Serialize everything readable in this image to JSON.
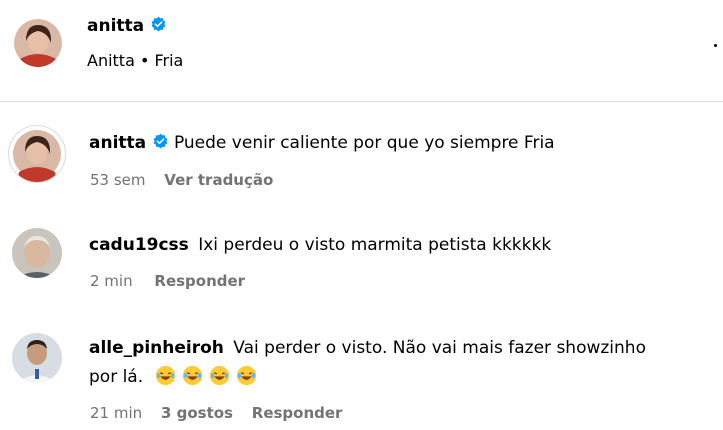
{
  "post_header": {
    "username": "anitta",
    "subtitle": "Anitta • Fria",
    "verified_icon": "verified-badge-icon",
    "menu_icon": "more-options-icon"
  },
  "comments": [
    {
      "username": "anitta",
      "verified": true,
      "text": "Puede venir caliente por que yo siempre Fria",
      "time": "53 sem",
      "action": "Ver tradução"
    },
    {
      "username": "cadu19css",
      "text": "Ixi perdeu o visto marmita petista kkkkkk",
      "time": "2 min",
      "action": "Responder"
    },
    {
      "username": "alle_pinheiroh",
      "text_line1": "Vai perder o visto. Não vai mais fazer showzinho",
      "text_line2": "por lá.",
      "emoji": [
        "rolling-laughing-emoji",
        "rolling-laughing-emoji",
        "rolling-laughing-emoji",
        "rolling-laughing-emoji"
      ],
      "time": "21 min",
      "likes": "3 gostos",
      "action": "Responder"
    }
  ],
  "colors": {
    "verified_blue": "#0095f6",
    "meta_gray": "#737373",
    "divider": "#dbdbdb"
  }
}
